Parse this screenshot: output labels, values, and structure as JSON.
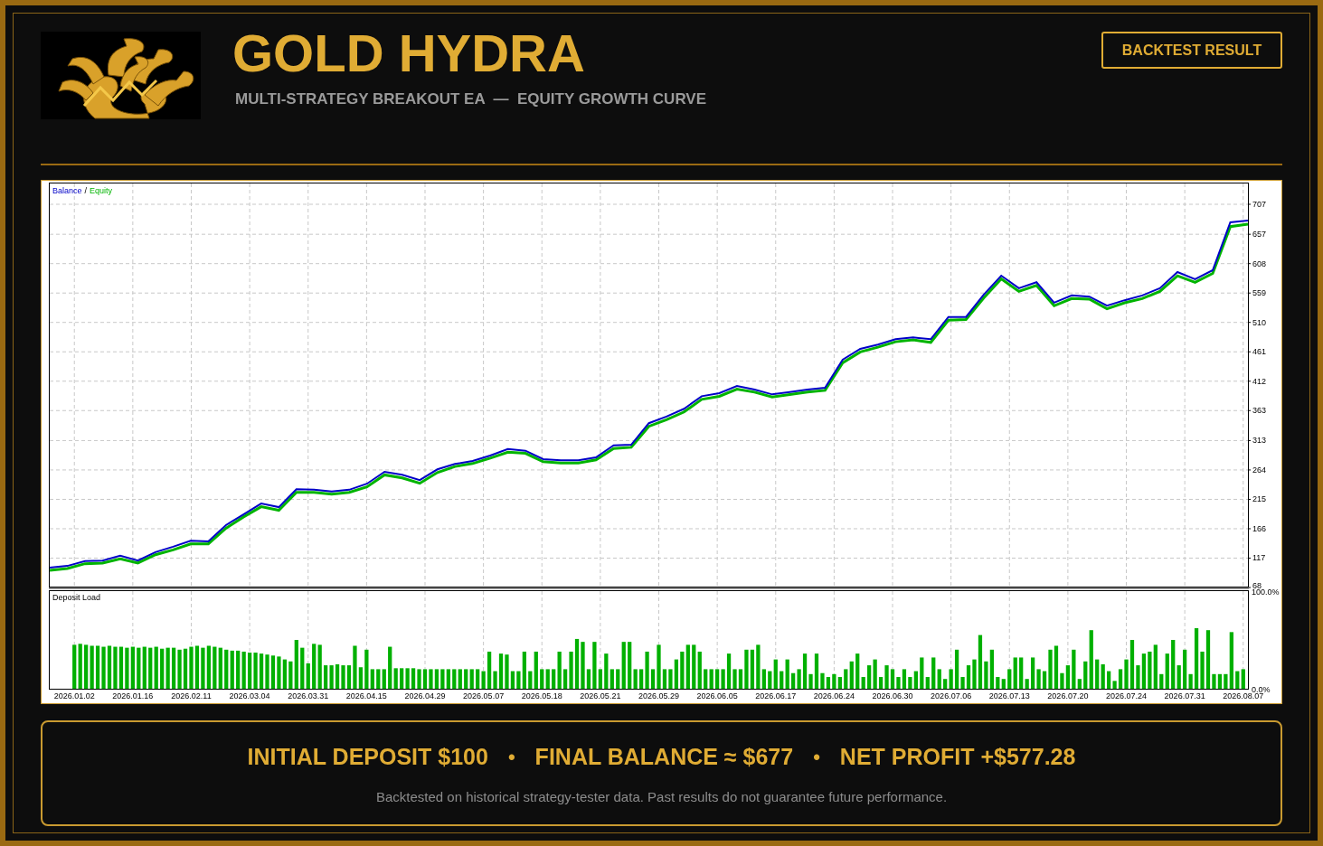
{
  "header": {
    "title": "GOLD HYDRA",
    "subtitle": "MULTI-STRATEGY BREAKOUT EA  —  EQUITY GROWTH CURVE",
    "button": "BACKTEST RESULT"
  },
  "balance_chart": {
    "legend_separator": "/",
    "chart_data": {
      "type": "line",
      "grid": true,
      "ylim": [
        68,
        707
      ],
      "yticks": [
        68,
        117,
        166,
        215,
        264,
        313,
        363,
        412,
        461,
        510,
        559,
        608,
        657,
        707
      ],
      "categories": [
        null,
        null,
        null,
        null,
        null,
        null,
        null,
        null,
        null,
        null,
        null,
        null,
        null,
        null,
        null,
        null,
        null,
        null,
        null,
        null,
        null,
        null,
        null,
        null,
        null,
        null,
        null,
        null,
        null,
        null,
        null,
        null,
        null,
        null,
        null,
        null,
        null,
        null,
        null,
        null,
        null,
        null,
        null,
        null,
        null,
        null,
        null,
        null,
        null,
        null,
        null,
        null,
        null,
        null,
        null,
        null,
        null,
        null,
        null,
        null,
        null,
        null,
        null,
        null,
        null,
        null,
        null,
        null,
        null
      ],
      "series": [
        {
          "name": "Balance",
          "color": "#0000c8",
          "values": [
            101,
            104,
            112,
            113,
            121,
            113,
            127,
            136,
            146,
            145,
            172,
            190,
            208,
            202,
            232,
            231,
            228,
            231,
            241,
            261,
            256,
            247,
            265,
            274,
            279,
            288,
            299,
            296,
            282,
            280,
            280,
            285,
            305,
            306,
            342,
            353,
            366,
            387,
            392,
            404,
            398,
            390,
            394,
            398,
            401,
            448,
            466,
            473,
            482,
            485,
            482,
            519,
            519,
            556,
            588,
            567,
            577,
            543,
            555,
            553,
            538,
            547,
            555,
            567,
            594,
            582,
            597,
            677,
            680
          ]
        },
        {
          "name": "Equity",
          "color": "#00b400",
          "values": [
            99,
            102,
            110,
            111,
            118,
            111,
            125,
            133,
            143,
            143,
            169,
            188,
            205,
            199,
            229,
            229,
            226,
            229,
            238,
            258,
            253,
            244,
            262,
            272,
            277,
            286,
            296,
            294,
            280,
            278,
            278,
            283,
            302,
            304,
            339,
            350,
            363,
            384,
            389,
            401,
            396,
            388,
            392,
            396,
            399,
            445,
            463,
            471,
            480,
            483,
            479,
            516,
            517,
            553,
            585,
            564,
            574,
            540,
            552,
            551,
            535,
            545,
            552,
            564,
            590,
            579,
            594,
            672,
            676
          ]
        }
      ]
    }
  },
  "deposit_chart": {
    "title": "Deposit Load",
    "chart_data": {
      "type": "bar",
      "grid": true,
      "ylim": [
        0,
        100
      ],
      "yticks": [
        {
          "value": 100,
          "label": "100.0%"
        },
        {
          "value": 0,
          "label": "0.0%"
        }
      ],
      "categories": [
        "2026.01.02",
        null,
        null,
        null,
        null,
        null,
        null,
        null,
        null,
        null,
        "2026.01.16",
        null,
        null,
        null,
        null,
        null,
        null,
        null,
        null,
        null,
        "2026.02.11",
        null,
        null,
        null,
        null,
        null,
        null,
        null,
        null,
        null,
        "2026.03.04",
        null,
        null,
        null,
        null,
        null,
        null,
        null,
        null,
        null,
        "2026.03.31",
        null,
        null,
        null,
        null,
        null,
        null,
        null,
        null,
        null,
        "2026.04.15",
        null,
        null,
        null,
        null,
        null,
        null,
        null,
        null,
        null,
        "2026.04.29",
        null,
        null,
        null,
        null,
        null,
        null,
        null,
        null,
        null,
        "2026.05.07",
        null,
        null,
        null,
        null,
        null,
        null,
        null,
        null,
        null,
        "2026.05.18",
        null,
        null,
        null,
        null,
        null,
        null,
        null,
        null,
        null,
        "2026.05.21",
        null,
        null,
        null,
        null,
        null,
        null,
        null,
        null,
        null,
        "2026.05.29",
        null,
        null,
        null,
        null,
        null,
        null,
        null,
        null,
        null,
        "2026.06.05",
        null,
        null,
        null,
        null,
        null,
        null,
        null,
        null,
        null,
        "2026.06.17",
        null,
        null,
        null,
        null,
        null,
        null,
        null,
        null,
        null,
        "2026.06.24",
        null,
        null,
        null,
        null,
        null,
        null,
        null,
        null,
        null,
        "2026.06.30",
        null,
        null,
        null,
        null,
        null,
        null,
        null,
        null,
        null,
        "2026.07.06",
        null,
        null,
        null,
        null,
        null,
        null,
        null,
        null,
        null,
        "2026.07.13",
        null,
        null,
        null,
        null,
        null,
        null,
        null,
        null,
        null,
        "2026.07.20",
        null,
        null,
        null,
        null,
        null,
        null,
        null,
        null,
        null,
        "2026.07.24",
        null,
        null,
        null,
        null,
        null,
        null,
        null,
        null,
        null,
        "2026.07.31",
        null,
        null,
        null,
        null,
        null,
        null,
        null,
        null,
        null,
        "2026.08.07"
      ],
      "values": [
        45,
        46,
        45,
        44,
        44,
        43,
        44,
        43,
        43,
        42,
        43,
        42,
        43,
        42,
        43,
        41,
        42,
        42,
        40,
        41,
        43,
        44,
        42,
        44,
        43,
        42,
        40,
        39,
        39,
        38,
        37,
        37,
        36,
        35,
        34,
        33,
        30,
        28,
        50,
        42,
        26,
        46,
        45,
        24,
        24,
        25,
        24,
        24,
        44,
        22,
        40,
        20,
        20,
        20,
        43,
        21,
        21,
        21,
        21,
        20,
        20,
        20,
        20,
        20,
        20,
        20,
        20,
        20,
        20,
        20,
        18,
        38,
        18,
        36,
        35,
        18,
        18,
        38,
        18,
        38,
        20,
        20,
        20,
        38,
        20,
        38,
        51,
        48,
        20,
        48,
        20,
        36,
        20,
        20,
        48,
        48,
        20,
        20,
        38,
        20,
        45,
        20,
        20,
        30,
        38,
        45,
        45,
        38,
        20,
        20,
        20,
        20,
        36,
        20,
        20,
        40,
        40,
        45,
        20,
        18,
        30,
        18,
        30,
        16,
        20,
        36,
        15,
        36,
        16,
        12,
        15,
        12,
        20,
        28,
        36,
        12,
        24,
        30,
        12,
        24,
        20,
        12,
        20,
        12,
        18,
        32,
        12,
        32,
        20,
        10,
        20,
        40,
        12,
        24,
        30,
        55,
        28,
        40,
        12,
        10,
        20,
        32,
        32,
        10,
        32,
        20,
        18,
        40,
        44,
        16,
        24,
        40,
        10,
        28,
        60,
        30,
        25,
        18,
        8,
        20,
        30,
        50,
        24,
        36,
        38,
        45,
        15,
        36,
        50,
        24,
        40,
        15,
        62,
        38,
        60,
        15,
        15,
        15,
        58,
        18,
        20
      ]
    }
  },
  "summary": {
    "items": [
      "INITIAL DEPOSIT $100",
      "FINAL BALANCE ≈ $677",
      "NET PROFIT +$577.28"
    ],
    "separators": [
      "•",
      "•"
    ],
    "note": "Backtested on historical strategy-tester data. Past results do not guarantee future performance."
  }
}
